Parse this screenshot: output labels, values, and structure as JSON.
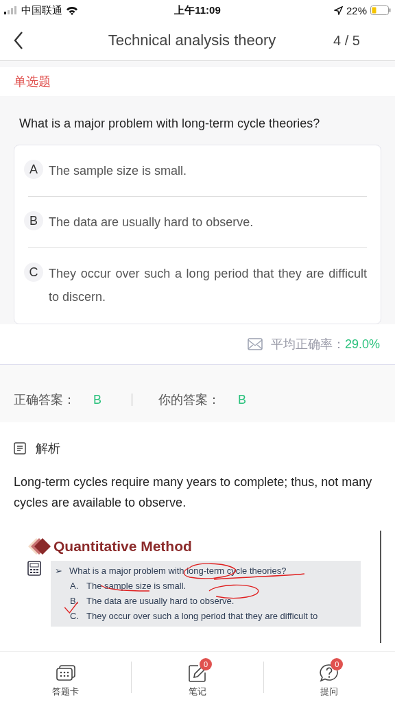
{
  "status_bar": {
    "carrier": "中国联通",
    "time": "上午11:09",
    "battery": "22%"
  },
  "header": {
    "title": "Technical analysis theory",
    "counter": "4 / 5"
  },
  "question_type": "单选题",
  "question": "What is a major problem with long-term cycle theories?",
  "options": [
    {
      "letter": "A",
      "text": "The sample size is small."
    },
    {
      "letter": "B",
      "text": "The data are usually hard to observe."
    },
    {
      "letter": "C",
      "text": "They occur over such a long period that they are difficult to discern."
    }
  ],
  "accuracy": {
    "label": "平均正确率：",
    "value": "29.0%"
  },
  "answers": {
    "correct_label": "正确答案：",
    "correct": "B",
    "yours_label": "你的答案：",
    "yours": "B"
  },
  "analysis": {
    "title": "解析",
    "text": "Long-term cycles require many years to complete; thus, not many cycles are available to observe."
  },
  "slide": {
    "title": "Quantitative Method",
    "bullet": "➢",
    "question": "What is a major problem with long-term cycle theories?",
    "options": [
      {
        "letter": "A.",
        "text": "The sample size is small."
      },
      {
        "letter": "B.",
        "text": "The data are usually hard to observe."
      },
      {
        "letter": "C.",
        "text": "They occur over such a long period that they are difficult to"
      }
    ]
  },
  "tab_bar": [
    {
      "kind": "card",
      "label": "答题卡"
    },
    {
      "kind": "note",
      "label": "笔记",
      "badge": "0"
    },
    {
      "kind": "ask",
      "label": "提问",
      "badge": "0"
    }
  ]
}
